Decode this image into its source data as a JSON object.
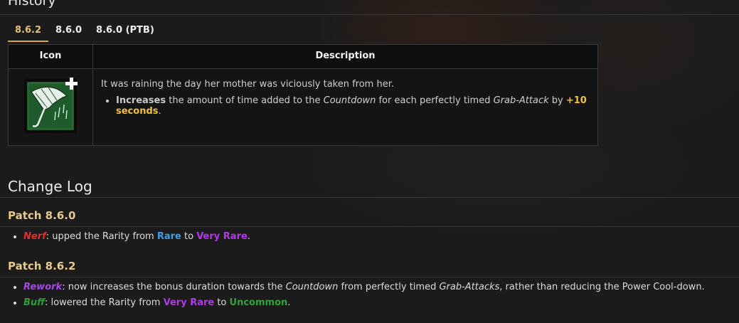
{
  "history": {
    "title": "History",
    "tabs": [
      "8.6.2",
      "8.6.0",
      "8.6.0 (PTB)"
    ],
    "active_tab": "8.6.2",
    "table": {
      "headers": {
        "icon": "Icon",
        "description": "Description"
      },
      "icon_name": "umbrella-perk-icon",
      "lore": "It was raining the day her mother was viciously taken from her.",
      "bullet": {
        "verb": "Increases",
        "text1": " the amount of time added to the ",
        "term1": "Countdown",
        "text2": " for each perfectly timed ",
        "term2": "Grab-Attack",
        "text3": " by ",
        "value": "+10 seconds",
        "text4": "."
      }
    }
  },
  "changelog": {
    "title": "Change Log",
    "patches": [
      {
        "title": "Patch 8.6.0",
        "entries": [
          {
            "tag": "Nerf",
            "pre": ": upped the Rarity from ",
            "from": "Rare",
            "mid": " to ",
            "to": "Very Rare",
            "post": "."
          }
        ]
      },
      {
        "title": "Patch 8.6.2",
        "entries": [
          {
            "tag": "Rework",
            "pre": ": now increases the bonus duration towards the ",
            "term1": "Countdown",
            "mid": " from perfectly timed ",
            "term2": "Grab-Attacks",
            "post": ", rather than reducing the Power Cool-down."
          },
          {
            "tag": "Buff",
            "pre": ": lowered the Rarity from ",
            "from": "Very Rare",
            "mid": " to ",
            "to": "Uncommon",
            "post": "."
          }
        ]
      }
    ]
  },
  "colors": {
    "accent": "#d9a441",
    "nerf": "#e0302e",
    "rework": "#a546e6",
    "buff": "#2f9d3a",
    "rare": "#3c9ee6",
    "very_rare": "#b13ae8",
    "uncommon": "#32a33c"
  }
}
